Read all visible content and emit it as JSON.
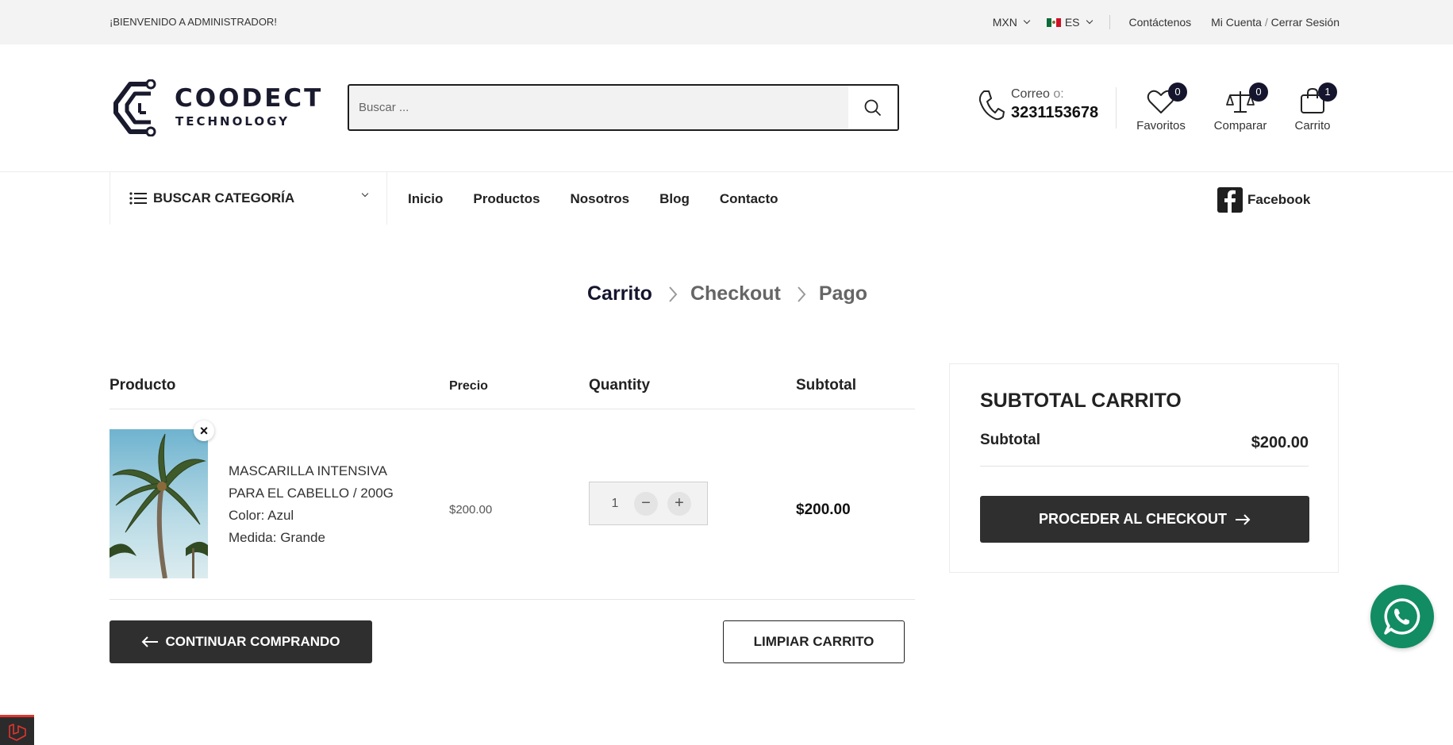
{
  "topbar": {
    "welcome": "¡BIENVENIDO A ADMINISTRADOR!",
    "currency": "MXN",
    "language": "ES",
    "contact_link": "Contáctenos",
    "account": "Mi Cuenta",
    "account_sep": "/",
    "logout": "Cerrar Sesión"
  },
  "logo": {
    "line1": "COODECT",
    "line2": "TECHNOLOGY"
  },
  "search": {
    "placeholder": "Buscar ..."
  },
  "contact": {
    "label": "Correo",
    "label_suffix": "o:",
    "phone": "3231153678"
  },
  "header_icons": {
    "wishlist": {
      "label": "Favoritos",
      "count": "0"
    },
    "compare": {
      "label": "Comparar",
      "count": "0"
    },
    "cart": {
      "label": "Carrito",
      "count": "1"
    }
  },
  "nav": {
    "category_label": "BUSCAR CATEGORÍA",
    "items": [
      "Inicio",
      "Productos",
      "Nosotros",
      "Blog",
      "Contacto"
    ],
    "social": "Facebook"
  },
  "steps": [
    "Carrito",
    "Checkout",
    "Pago"
  ],
  "cart": {
    "headers": {
      "product": "Producto",
      "price": "Precio",
      "quantity": "Quantity",
      "subtotal": "Subtotal"
    },
    "items": [
      {
        "name": "MASCARILLA INTENSIVA PARA EL CABELLO / 200G",
        "color": "Color: Azul",
        "size": "Medida: Grande",
        "price": "$200.00",
        "quantity": "1",
        "subtotal": "$200.00"
      }
    ],
    "continue_label": "CONTINUAR COMPRANDO",
    "clear_label": "LIMPIAR CARRITO"
  },
  "totals": {
    "title": "SUBTOTAL CARRITO",
    "subtotal_label": "Subtotal",
    "subtotal_value": "$200.00",
    "checkout_label": "PROCEDER AL CHECKOUT"
  },
  "colors": {
    "dark": "#2f2f2f",
    "navy": "#15152e",
    "whatsapp": "#128c62"
  }
}
